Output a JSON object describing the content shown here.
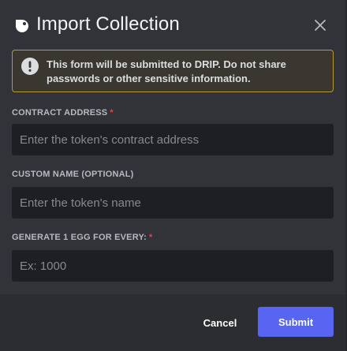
{
  "header": {
    "title": "Import Collection",
    "logo_icon": "drip-logo-icon",
    "close_icon": "close-icon"
  },
  "notice": {
    "icon": "exclamation-icon",
    "text": "This form will be submitted to DRIP. Do not share passwords or other sensitive information."
  },
  "form": {
    "contract_address": {
      "label": "CONTRACT ADDRESS",
      "required": "*",
      "value": "",
      "placeholder": "Enter the token's contract address"
    },
    "custom_name": {
      "label": "CUSTOM NAME (OPTIONAL)",
      "value": "",
      "placeholder": "Enter the token's name"
    },
    "egg_rate": {
      "label": "GENERATE 1 EGG FOR EVERY:",
      "required": "*",
      "value": "",
      "placeholder": "Ex: 1000"
    }
  },
  "footer": {
    "cancel_label": "Cancel",
    "submit_label": "Submit"
  },
  "colors": {
    "background": "#313338",
    "footer": "#2b2d31",
    "input": "#1e1f22",
    "notice_border": "#b89a31",
    "required": "#f23f43",
    "primary": "#5865f2"
  }
}
